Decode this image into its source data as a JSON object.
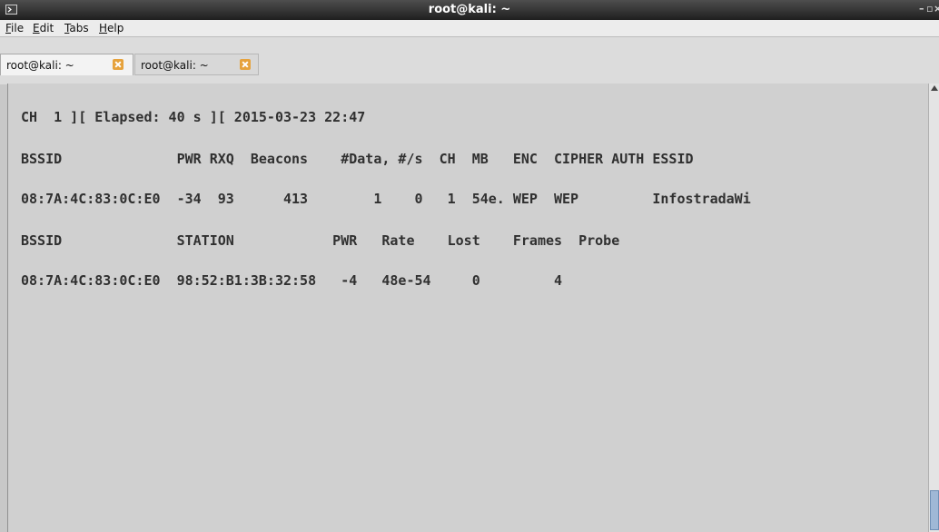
{
  "window": {
    "title": "root@kali: ~",
    "minimize": "–",
    "maximize": "▫",
    "close": "×"
  },
  "menubar": {
    "file": {
      "acc": "F",
      "rest": "ile"
    },
    "edit": {
      "acc": "E",
      "rest": "dit"
    },
    "tabs": {
      "acc": "T",
      "rest": "abs"
    },
    "help": {
      "acc": "H",
      "rest": "elp"
    }
  },
  "tabs": [
    {
      "label": "root@kali: ~"
    },
    {
      "label": "root@kali: ~"
    }
  ],
  "terminal": {
    "lines": [
      "CH  1 ][ Elapsed: 40 s ][ 2015-03-23 22:47",
      "BSSID              PWR RXQ  Beacons    #Data, #/s  CH  MB   ENC  CIPHER AUTH ESSID",
      "08:7A:4C:83:0C:E0  -34  93      413        1    0   1  54e. WEP  WEP         InfostradaWi",
      "BSSID              STATION            PWR   Rate    Lost    Frames  Probe",
      "08:7A:4C:83:0C:E0  98:52:B1:3B:32:58   -4   48e-54     0         4"
    ]
  },
  "colors": {
    "terminal_bg": "#d0d0d0",
    "terminal_fg": "#303030",
    "titlebar": "#2a2a2a",
    "tab_close": "#e6a23c"
  }
}
